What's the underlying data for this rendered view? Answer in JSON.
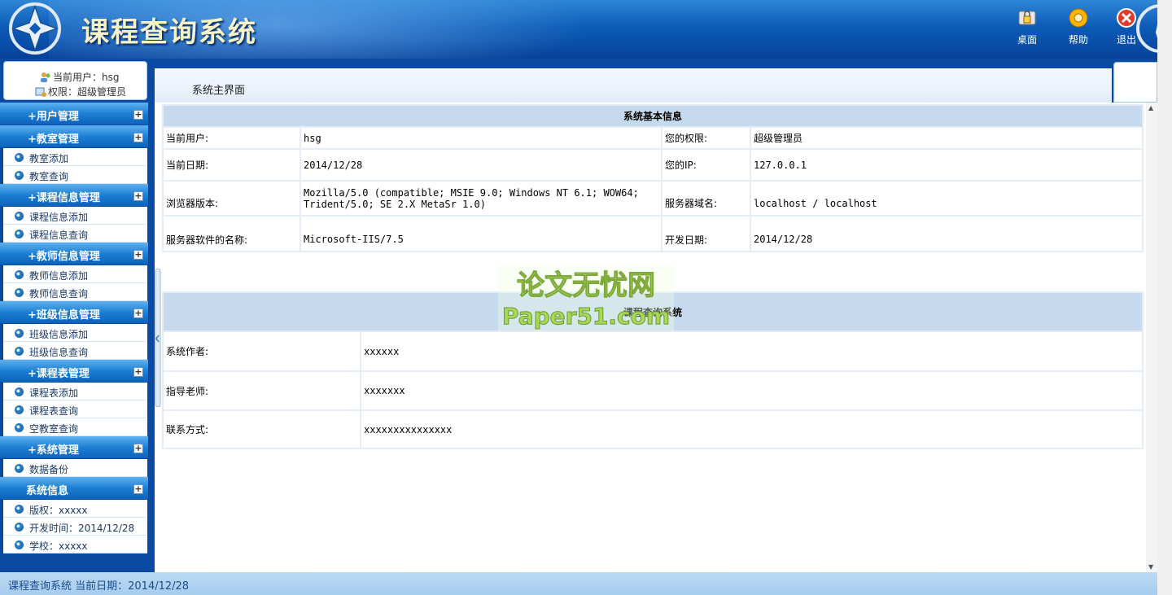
{
  "header": {
    "title": "课程查询系统",
    "tools": [
      {
        "label": "桌面",
        "icon": "desktop-lock-icon"
      },
      {
        "label": "帮助",
        "icon": "help-gear-icon"
      },
      {
        "label": "退出",
        "icon": "exit-close-icon"
      }
    ]
  },
  "user_box": {
    "current_user": "当前用户：hsg",
    "permission": "权限：超级管理员"
  },
  "menu": [
    {
      "title": "+用户管理",
      "items": []
    },
    {
      "title": "+教室管理",
      "items": [
        "教室添加",
        "教室查询"
      ]
    },
    {
      "title": "+课程信息管理",
      "items": [
        "课程信息添加",
        "课程信息查询"
      ]
    },
    {
      "title": "+教师信息管理",
      "items": [
        "教师信息添加",
        "教师信息查询"
      ]
    },
    {
      "title": "+班级信息管理",
      "items": [
        "班级信息添加",
        "班级信息查询"
      ]
    },
    {
      "title": "+课程表管理",
      "items": [
        "课程表添加",
        "课程表查询",
        "空教室查询"
      ]
    },
    {
      "title": "+系统管理",
      "items": [
        "数据备份"
      ]
    },
    {
      "title": "系统信息",
      "items": [
        "版权：xxxxx",
        "开发时间：2014/12/28",
        "学校：xxxxx"
      ]
    }
  ],
  "main": {
    "tab_title": "系统主界面",
    "info_caption": "系统基本信息",
    "info_rows": [
      {
        "l1": "当前用户:",
        "v1": "hsg",
        "l2": "您的权限:",
        "v2": "超级管理员"
      },
      {
        "l1": "当前日期:",
        "v1": "2014/12/28",
        "l2": "您的IP:",
        "v2": "127.0.0.1"
      },
      {
        "l1": "浏览器版本:",
        "v1": "Mozilla/5.0 (compatible; MSIE 9.0; Windows NT 6.1; WOW64; Trident/5.0; SE 2.X MetaSr 1.0)",
        "l2": "服务器域名:",
        "v2": "localhost / localhost"
      },
      {
        "l1": "服务器软件的名称:",
        "v1": "Microsoft-IIS/7.5",
        "l2": "开发日期:",
        "v2": "2014/12/28"
      }
    ],
    "sys_caption": "课程查询系统",
    "sys_rows": [
      {
        "label": "系统作者:",
        "value": "xxxxxx"
      },
      {
        "label": "指导老师:",
        "value": "xxxxxxx"
      },
      {
        "label": "联系方式:",
        "value": "xxxxxxxxxxxxxxx"
      }
    ],
    "watermark": {
      "line1": "论文无忧网",
      "line2": "Paper51.com"
    }
  },
  "footer": {
    "text": "课程查询系统 当前日期：2014/12/28"
  },
  "colors": {
    "header_dark": "#06429a",
    "sidebar_bg": "#0a4aa2",
    "caption_bg": "#c6daed",
    "title_text": "#f6f3c8"
  }
}
